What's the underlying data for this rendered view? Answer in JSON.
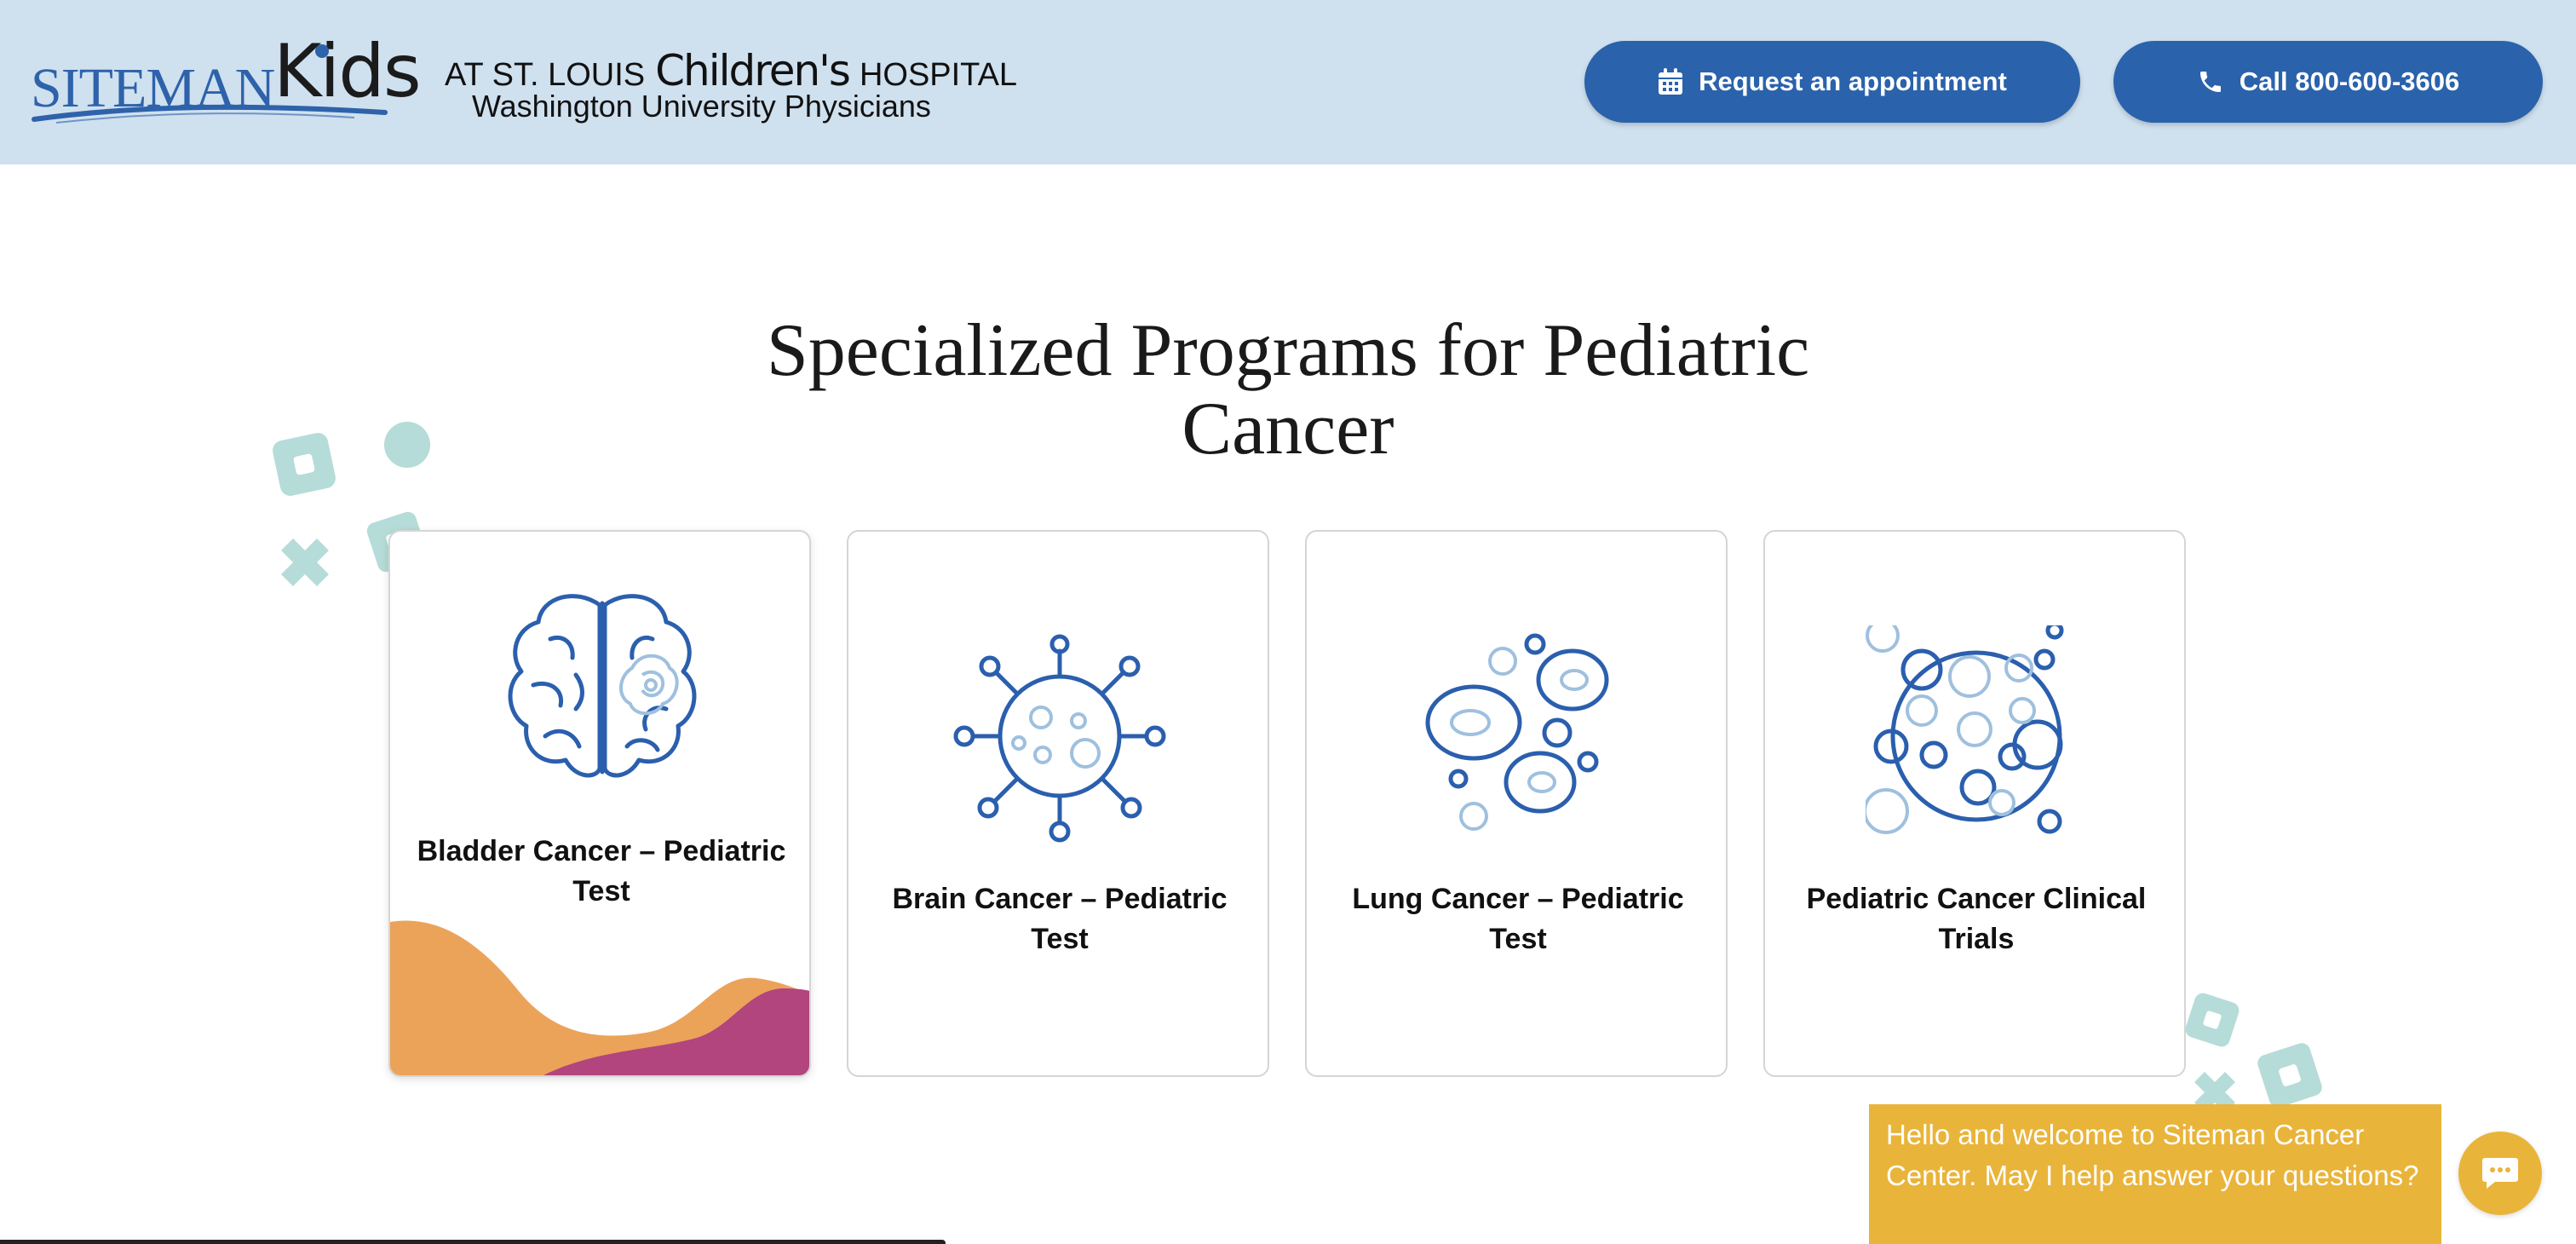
{
  "header": {
    "logo": {
      "brand": "SITEMAN",
      "sub": "Kids"
    },
    "hospital": {
      "prefix": "AT ST. LOUIS",
      "children": "Children's",
      "suffix": "HOSPITAL",
      "affiliation": "Washington University Physicians"
    },
    "appointment_label": "Request an appointment",
    "call_label": "Call 800-600-3606"
  },
  "main": {
    "title": "Specialized Programs for Pediatric Cancer",
    "cards": [
      {
        "label": "Bladder Cancer – Pediatric Test",
        "icon": "brain-tumor-icon"
      },
      {
        "label": "Brain Cancer – Pediatric Test",
        "icon": "virus-cell-icon"
      },
      {
        "label": "Lung Cancer – Pediatric Test",
        "icon": "cells-icon"
      },
      {
        "label": "Pediatric Cancer Clinical Trials",
        "icon": "cell-cluster-icon"
      }
    ]
  },
  "chat": {
    "message": "Hello and welcome to Siteman Cancer Center. May I help answer your questions?"
  },
  "colors": {
    "header_bg": "#cfe0ef",
    "button_blue": "#2a62ac",
    "icon_dark": "#2b5fae",
    "icon_light": "#9fc0de",
    "wave_orange": "#eba35a",
    "wave_magenta": "#b2457e",
    "chat_yellow": "#e9b43a",
    "deco_teal": "#b5dcd8"
  }
}
